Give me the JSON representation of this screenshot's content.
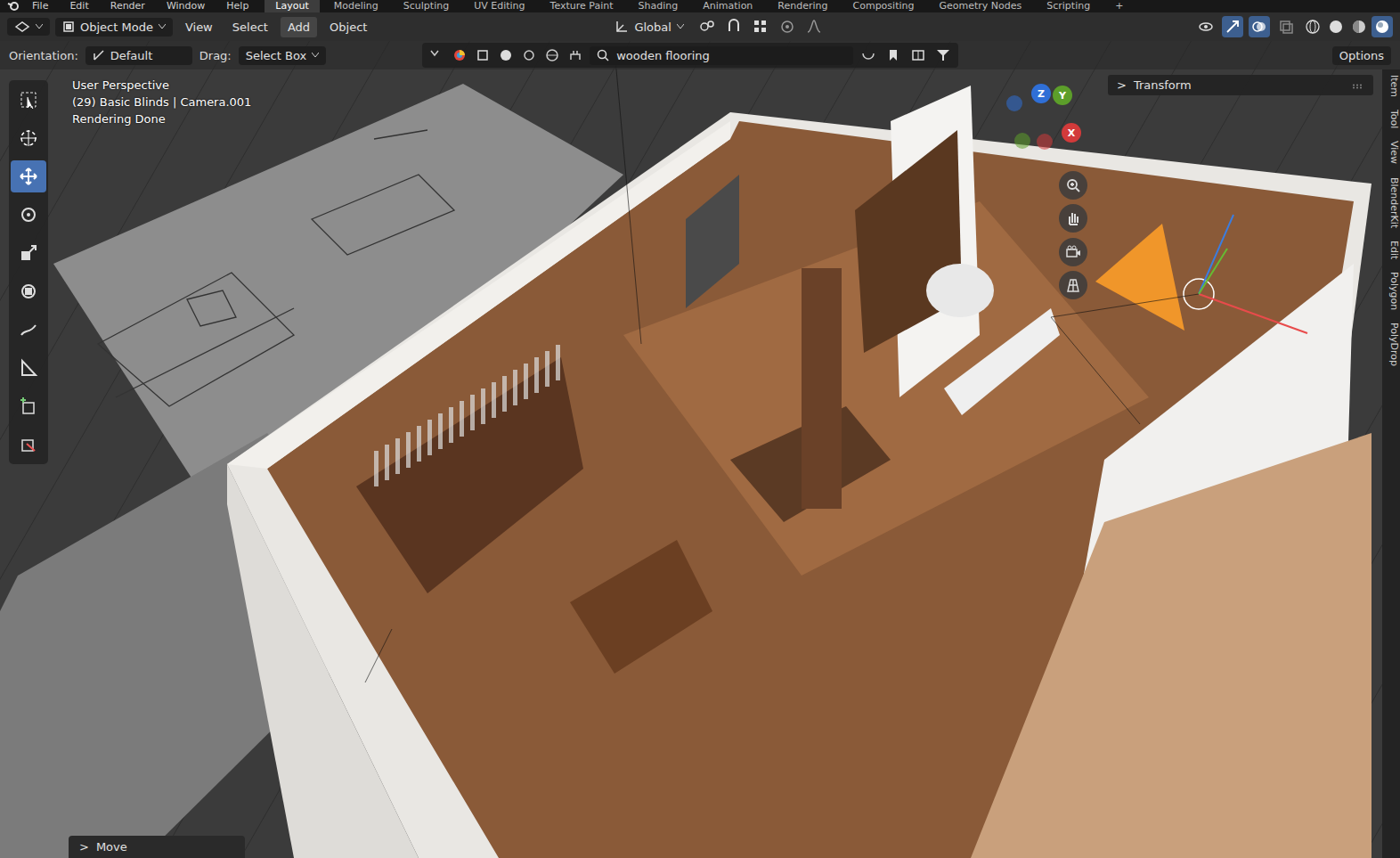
{
  "topbar": {
    "menus": [
      "File",
      "Edit",
      "Render",
      "Window",
      "Help"
    ],
    "workspaces": [
      {
        "label": "Layout",
        "selected": true
      },
      {
        "label": "Modeling",
        "selected": false
      },
      {
        "label": "Sculpting",
        "selected": false
      },
      {
        "label": "UV Editing",
        "selected": false
      },
      {
        "label": "Texture Paint",
        "selected": false
      },
      {
        "label": "Shading",
        "selected": false
      },
      {
        "label": "Animation",
        "selected": false
      },
      {
        "label": "Rendering",
        "selected": false
      },
      {
        "label": "Compositing",
        "selected": false
      },
      {
        "label": "Geometry Nodes",
        "selected": false
      },
      {
        "label": "Scripting",
        "selected": false
      },
      {
        "label": "+",
        "selected": false
      }
    ]
  },
  "header": {
    "mode": "Object Mode",
    "menus": [
      {
        "label": "View",
        "selected": false
      },
      {
        "label": "Select",
        "selected": false
      },
      {
        "label": "Add",
        "selected": true
      },
      {
        "label": "Object",
        "selected": false
      }
    ],
    "orientation": "Global",
    "toggles": [
      {
        "kind": "visibility",
        "on": false
      },
      {
        "kind": "gizmos",
        "on": true
      },
      {
        "kind": "overlays",
        "on": true
      },
      {
        "kind": "xray",
        "on": false
      }
    ],
    "shading": [
      {
        "kind": "wireframe",
        "selected": false
      },
      {
        "kind": "solid",
        "selected": false
      },
      {
        "kind": "material",
        "selected": false
      },
      {
        "kind": "rendered",
        "selected": true
      }
    ]
  },
  "tool_settings": {
    "orientation_label": "Orientation:",
    "orientation": "Default",
    "drag_label": "Drag:",
    "drag": "Select Box",
    "search": "wooden flooring",
    "options": "Options"
  },
  "toolbar": [
    {
      "kind": "select",
      "selected": false
    },
    {
      "kind": "cursor",
      "selected": false
    },
    {
      "kind": "move",
      "selected": true
    },
    {
      "kind": "rotate",
      "selected": false
    },
    {
      "kind": "scale",
      "selected": false
    },
    {
      "kind": "transform",
      "selected": false
    },
    {
      "kind": "annotate",
      "selected": false
    },
    {
      "kind": "measure",
      "selected": false
    },
    {
      "kind": "addcube",
      "selected": false
    },
    {
      "kind": "addobject",
      "selected": false
    }
  ],
  "viewport": {
    "info": [
      "User Perspective",
      "(29) Basic Blinds | Camera.001",
      "Rendering Done"
    ]
  },
  "gizmo": {
    "axes": [
      {
        "label": "Z",
        "color": "#2f6fd6"
      },
      {
        "label": "Y",
        "color": "#5c9e2a"
      },
      {
        "label": "X",
        "color": "#d23a3a"
      }
    ]
  },
  "sidebar": {
    "chevron": ">",
    "panel": "Transform",
    "tabs": [
      "Item",
      "Tool",
      "View",
      "BlenderKit",
      "Edit",
      "Polygon",
      "PolyDrop"
    ]
  },
  "operator_panel": {
    "chevron": ">",
    "label": "Move"
  }
}
